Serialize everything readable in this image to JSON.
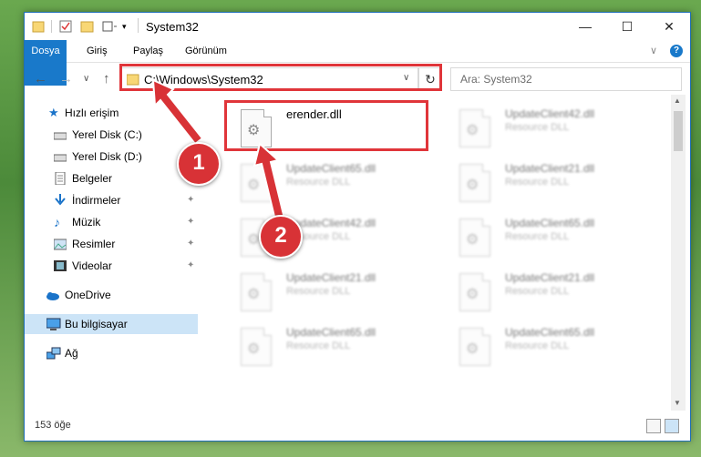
{
  "window": {
    "title": "System32",
    "minimize": "—",
    "maximize": "☐",
    "close": "✕"
  },
  "ribbon": {
    "tabs": [
      "Dosya",
      "Giriş",
      "Paylaş",
      "Görünüm"
    ],
    "collapse": "∨",
    "help": "?"
  },
  "nav": {
    "back": "←",
    "forward": "→",
    "recent": "∨",
    "up": "↑"
  },
  "address": {
    "path": "C:\\Windows\\System32",
    "dropdown": "∨",
    "refresh": "↻"
  },
  "search": {
    "placeholder": "Ara: System32",
    "icon": "⚲"
  },
  "sidebar": {
    "items": [
      {
        "label": "Hızlı erişim",
        "icon": "star-icon"
      },
      {
        "label": "Yerel Disk (C:)",
        "icon": "drive-icon",
        "pinned": true
      },
      {
        "label": "Yerel Disk (D:)",
        "icon": "drive-icon",
        "pinned": true
      },
      {
        "label": "Belgeler",
        "icon": "documents-icon",
        "pinned": true
      },
      {
        "label": "İndirmeler",
        "icon": "downloads-icon",
        "pinned": true
      },
      {
        "label": "Müzik",
        "icon": "music-icon",
        "pinned": true
      },
      {
        "label": "Resimler",
        "icon": "pictures-icon",
        "pinned": true
      },
      {
        "label": "Videolar",
        "icon": "videos-icon",
        "pinned": true
      },
      {
        "label": "OneDrive",
        "icon": "cloud-icon"
      },
      {
        "label": "Bu bilgisayar",
        "icon": "computer-icon",
        "selected": true
      },
      {
        "label": "Ağ",
        "icon": "network-icon"
      }
    ],
    "pin_glyph": "📌"
  },
  "files": {
    "highlighted": {
      "name": "erender.dll",
      "type": ""
    },
    "blurred": [
      {
        "name": "UpdateClient42.dll",
        "type": "Resource DLL"
      },
      {
        "name": "UpdateClient65.dll",
        "type": "Resource DLL"
      },
      {
        "name": "UpdateClient21.dll",
        "type": "Resource DLL"
      },
      {
        "name": "UpdateClient42.dll",
        "type": "Resource DLL"
      },
      {
        "name": "UpdateClient65.dll",
        "type": "Resource DLL"
      },
      {
        "name": "UpdateClient21.dll",
        "type": "Resource DLL"
      },
      {
        "name": "UpdateClient21.dll",
        "type": "Resource DLL"
      },
      {
        "name": "UpdateClient65.dll",
        "type": "Resource DLL"
      },
      {
        "name": "UpdateClient65.dll",
        "type": "Resource DLL"
      }
    ]
  },
  "status": {
    "count": "153 öğe"
  },
  "annotations": {
    "step1": "1",
    "step2": "2",
    "color": "#d83236"
  }
}
